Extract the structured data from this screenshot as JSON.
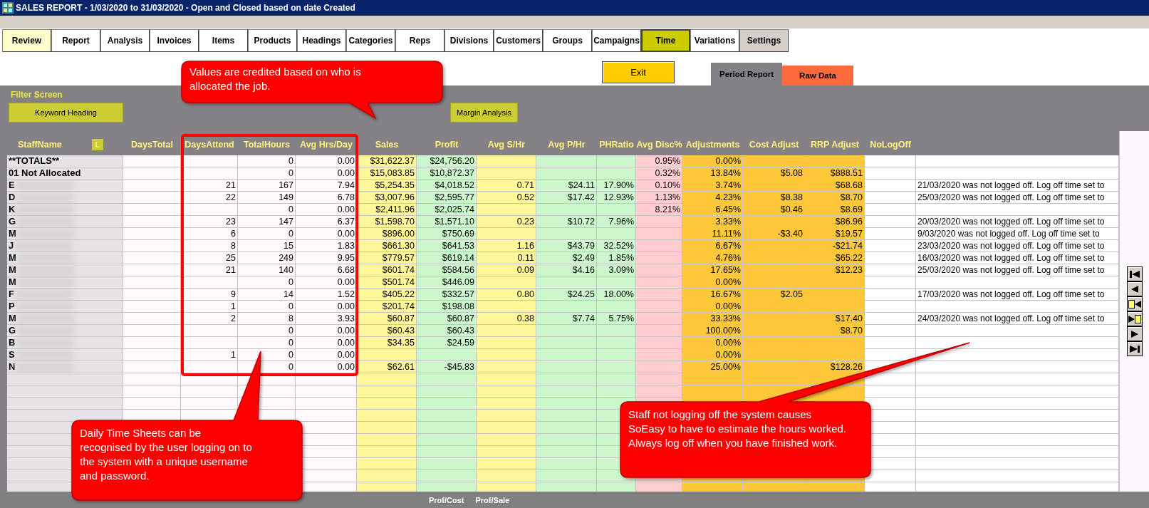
{
  "window": {
    "title": "SALES REPORT -  1/03/2020 to 31/03/2020 - Open and Closed based on date Created"
  },
  "tabs": [
    {
      "label": "Review",
      "selected": false,
      "color": "#ffffcc"
    },
    {
      "label": "Report",
      "selected": false,
      "color": "#ffffff"
    },
    {
      "label": "Analysis",
      "selected": false,
      "color": "#ffffff"
    },
    {
      "label": "Invoices",
      "selected": false,
      "color": "#ffffff"
    },
    {
      "label": "Items",
      "selected": false,
      "color": "#ffffff"
    },
    {
      "label": "Products",
      "selected": false,
      "color": "#ffffff"
    },
    {
      "label": "Headings",
      "selected": false,
      "color": "#ffffff"
    },
    {
      "label": "Categories",
      "selected": false,
      "color": "#ffffff"
    },
    {
      "label": "Reps",
      "selected": false,
      "color": "#ffffff"
    },
    {
      "label": "Divisions",
      "selected": false,
      "color": "#ffffff"
    },
    {
      "label": "Customers",
      "selected": false,
      "color": "#ffffff"
    },
    {
      "label": "Groups",
      "selected": false,
      "color": "#ffffff"
    },
    {
      "label": "Campaigns",
      "selected": false,
      "color": "#ffffff"
    },
    {
      "label": "Time",
      "selected": true,
      "color": "#cccc00"
    },
    {
      "label": "Variations",
      "selected": false,
      "color": "#ffffff"
    },
    {
      "label": "Settings",
      "selected": false,
      "color": "#d4d0c8"
    }
  ],
  "exit_button": "Exit",
  "view_tabs": [
    {
      "label": "Period Report",
      "selected": true,
      "color": "#858287"
    },
    {
      "label": "Raw Data",
      "selected": false,
      "color": "#ff6a3d"
    }
  ],
  "filter": {
    "title": "Filter Screen",
    "buttons": [
      "Keyword Heading",
      "Margin Analysis"
    ]
  },
  "table": {
    "sort_button": "L",
    "columns": [
      {
        "label": "StaffName",
        "color": "#e6e2e6"
      },
      {
        "label": "DaysTotal",
        "color": "#fff9fd"
      },
      {
        "label": "DaysAttend",
        "color": "#fff9fd"
      },
      {
        "label": "TotalHours",
        "color": "#fff9fd"
      },
      {
        "label": "Avg Hrs/Day",
        "color": "#fff9fd"
      },
      {
        "label": "Sales",
        "color": "#fff799"
      },
      {
        "label": "Profit",
        "color": "#ccf7cc"
      },
      {
        "label": "Avg S/Hr",
        "color": "#fff799"
      },
      {
        "label": "Avg P/Hr",
        "color": "#ccf7cc"
      },
      {
        "label": "PHRatio",
        "color": "#ccf7cc"
      },
      {
        "label": "Avg Disc%",
        "color": "#ffccd0"
      },
      {
        "label": "Adjustments",
        "color": "#ffc83a"
      },
      {
        "label": "Cost Adjust",
        "color": "#ffc83a"
      },
      {
        "label": "RRP Adjust",
        "color": "#ffc83a"
      },
      {
        "label": "NoLogOff",
        "color": "#ffffff"
      },
      {
        "color": "#ffffff"
      }
    ],
    "rows": [
      {
        "redacted": false,
        "cells": [
          "**TOTALS**",
          null,
          null,
          "0",
          "0.00",
          "$31,622.37",
          "$24,756.20",
          null,
          null,
          null,
          "0.95%",
          "0.00%",
          null,
          null,
          null,
          null
        ]
      },
      {
        "redacted": false,
        "cells": [
          "01 Not Allocated",
          null,
          null,
          "0",
          "0.00",
          "$15,083.85",
          "$10,872.37",
          null,
          null,
          null,
          "0.32%",
          "13.84%",
          "$5.08",
          "$888.51",
          null,
          null
        ]
      },
      {
        "redacted": true,
        "cells": [
          "E",
          null,
          "21",
          "167",
          "7.94",
          "$5,254.35",
          "$4,018.52",
          "0.71",
          "$24.11",
          "17.90%",
          "0.10%",
          "3.74%",
          null,
          "$68.68",
          null,
          "21/03/2020 was not logged off. Log off time set to"
        ]
      },
      {
        "redacted": true,
        "cells": [
          "D",
          null,
          "22",
          "149",
          "6.78",
          "$3,007.96",
          "$2,595.77",
          "0.52",
          "$17.42",
          "12.93%",
          "1.13%",
          "4.23%",
          "$8.38",
          "$8.70",
          null,
          "25/03/2020 was not logged off. Log off time set to"
        ]
      },
      {
        "redacted": true,
        "cells": [
          "K",
          null,
          null,
          "0",
          "0.00",
          "$2,411.96",
          "$2,025.74",
          null,
          null,
          null,
          "8.21%",
          "6.45%",
          "$0.46",
          "$8.69",
          null,
          null
        ]
      },
      {
        "redacted": true,
        "cells": [
          "G",
          null,
          "23",
          "147",
          "6.37",
          "$1,598.70",
          "$1,571.10",
          "0.23",
          "$10.72",
          "7.96%",
          null,
          "3.33%",
          null,
          "$86.96",
          null,
          "20/03/2020 was not logged off. Log off time set to"
        ]
      },
      {
        "redacted": true,
        "cells": [
          "M",
          null,
          "6",
          "0",
          "0.00",
          "$896.00",
          "$750.69",
          null,
          null,
          null,
          null,
          "11.11%",
          "-$3.40",
          "$19.57",
          null,
          "9/03/2020 was not logged off. Log off time set to"
        ]
      },
      {
        "redacted": true,
        "cells": [
          "J",
          null,
          "8",
          "15",
          "1.83",
          "$661.30",
          "$641.53",
          "1.16",
          "$43.79",
          "32.52%",
          null,
          "6.67%",
          null,
          "-$21.74",
          null,
          "23/03/2020 was not logged off. Log off time set to"
        ]
      },
      {
        "redacted": true,
        "cells": [
          "M",
          null,
          "25",
          "249",
          "9.95",
          "$779.57",
          "$619.14",
          "0.11",
          "$2.49",
          "1.85%",
          null,
          "4.76%",
          null,
          "$65.22",
          null,
          "16/03/2020 was not logged off. Log off time set to"
        ]
      },
      {
        "redacted": true,
        "cells": [
          "M",
          null,
          "21",
          "140",
          "6.68",
          "$601.74",
          "$584.56",
          "0.09",
          "$4.16",
          "3.09%",
          null,
          "17.65%",
          null,
          "$12.23",
          null,
          "25/03/2020 was not logged off. Log off time set to"
        ]
      },
      {
        "redacted": true,
        "cells": [
          "M",
          null,
          null,
          "0",
          "0.00",
          "$501.74",
          "$446.09",
          null,
          null,
          null,
          null,
          "0.00%",
          null,
          null,
          null,
          null
        ]
      },
      {
        "redacted": true,
        "cells": [
          "F",
          null,
          "9",
          "14",
          "1.52",
          "$405.22",
          "$332.57",
          "0.80",
          "$24.25",
          "18.00%",
          null,
          "16.67%",
          "$2.05",
          null,
          null,
          "17/03/2020 was not logged off. Log off time set to"
        ]
      },
      {
        "redacted": true,
        "cells": [
          "P",
          null,
          "1",
          "0",
          "0.00",
          "$201.74",
          "$198.08",
          null,
          null,
          null,
          null,
          "0.00%",
          null,
          null,
          null,
          null
        ]
      },
      {
        "redacted": true,
        "cells": [
          "M",
          null,
          "2",
          "8",
          "3.93",
          "$60.87",
          "$60.87",
          "0.38",
          "$7.74",
          "5.75%",
          null,
          "33.33%",
          null,
          "$17.40",
          null,
          "24/03/2020 was not logged off. Log off time set to"
        ]
      },
      {
        "redacted": true,
        "cells": [
          "G",
          null,
          null,
          "0",
          "0.00",
          "$60.43",
          "$60.43",
          null,
          null,
          null,
          null,
          "100.00%",
          null,
          "$8.70",
          null,
          null
        ]
      },
      {
        "redacted": true,
        "cells": [
          "B",
          null,
          null,
          "0",
          "0.00",
          "$34.35",
          "$24.59",
          null,
          null,
          null,
          null,
          "0.00%",
          null,
          null,
          null,
          null
        ]
      },
      {
        "redacted": true,
        "cells": [
          "S",
          null,
          "1",
          "0",
          "0.00",
          null,
          null,
          null,
          null,
          null,
          null,
          "0.00%",
          null,
          null,
          null,
          null
        ]
      },
      {
        "redacted": true,
        "cells": [
          "N",
          null,
          null,
          "0",
          "0.00",
          "$62.61",
          "-$45.83",
          null,
          null,
          null,
          null,
          "25.00%",
          null,
          "$128.26",
          null,
          null
        ]
      }
    ]
  },
  "footer": [
    "Prof/Cost",
    "Prof/Sale"
  ],
  "callouts": [
    "Values are credited based on who is allocated the job.",
    "Daily Time Sheets can be recognised by the user logging on to the system with a unique username and password.",
    "Staff not logging off the system causes SoEasy to have to estimate the hours worked. Always log off when you have finished work."
  ]
}
